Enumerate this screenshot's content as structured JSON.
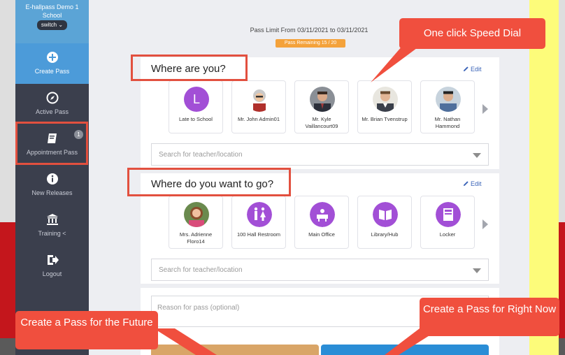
{
  "sidebar": {
    "school_name": "E-hallpass Demo 1",
    "school_label": "School",
    "switch_label": "switch",
    "items": [
      {
        "label": "Create Pass",
        "icon": "plus-circle-icon",
        "active": true
      },
      {
        "label": "Active Pass",
        "icon": "compass-icon"
      },
      {
        "label": "Appointment Pass",
        "icon": "book-icon",
        "badge": "1"
      },
      {
        "label": "New Releases",
        "icon": "info-icon"
      },
      {
        "label": "Training <",
        "icon": "bank-icon"
      },
      {
        "label": "Logout",
        "icon": "logout-icon"
      }
    ]
  },
  "header": {
    "pass_limit": "Pass Limit From 03/11/2021 to 03/11/2021",
    "remaining": "Pass Remaining 15 / 20"
  },
  "from_section": {
    "title": "Where are you?",
    "edit_label": "Edit",
    "tiles": [
      {
        "label": "Late to School",
        "type": "letter",
        "letter": "L",
        "color": "#a24fd6"
      },
      {
        "label": "Mr. John Admin01",
        "type": "person",
        "icon": "cartoon-avatar-icon"
      },
      {
        "label": "Mr. Kyle Vaillancourt09",
        "type": "person",
        "icon": "person-photo-icon"
      },
      {
        "label": "Mr. Brian Tvenstrup",
        "type": "person",
        "icon": "person-photo-icon"
      },
      {
        "label": "Mr. Nathan Hammond",
        "type": "person",
        "icon": "person-photo-icon"
      }
    ],
    "search_placeholder": "Search for teacher/location"
  },
  "to_section": {
    "title": "Where do you want to go?",
    "edit_label": "Edit",
    "tiles": [
      {
        "label": "Mrs. Adrienne Floro14",
        "type": "person",
        "icon": "person-photo-icon"
      },
      {
        "label": "100 Hall Restroom",
        "type": "icon",
        "icon": "restroom-icon",
        "color": "#a24fd6"
      },
      {
        "label": "Main Office",
        "type": "icon",
        "icon": "office-icon",
        "color": "#a24fd6"
      },
      {
        "label": "Library/Hub",
        "type": "icon",
        "icon": "book-open-icon",
        "color": "#a24fd6"
      },
      {
        "label": "Locker",
        "type": "icon",
        "icon": "locker-icon",
        "color": "#a24fd6"
      }
    ],
    "search_placeholder": "Search for teacher/location"
  },
  "reason": {
    "placeholder": "Reason for pass (optional)"
  },
  "annotations": {
    "speed_dial": "One click Speed Dial",
    "future": "Create a Pass for the Future",
    "right_now": "Create a Pass for Right Now"
  },
  "colors": {
    "sidebar_bg": "#3b3f4d",
    "sidebar_active": "#4c9bd9",
    "accent_purple": "#a24fd6",
    "annotation_red": "#f04f3e",
    "remaining_badge": "#f4a23b",
    "button_future": "#d9a567",
    "button_now": "#2a8dd6"
  }
}
